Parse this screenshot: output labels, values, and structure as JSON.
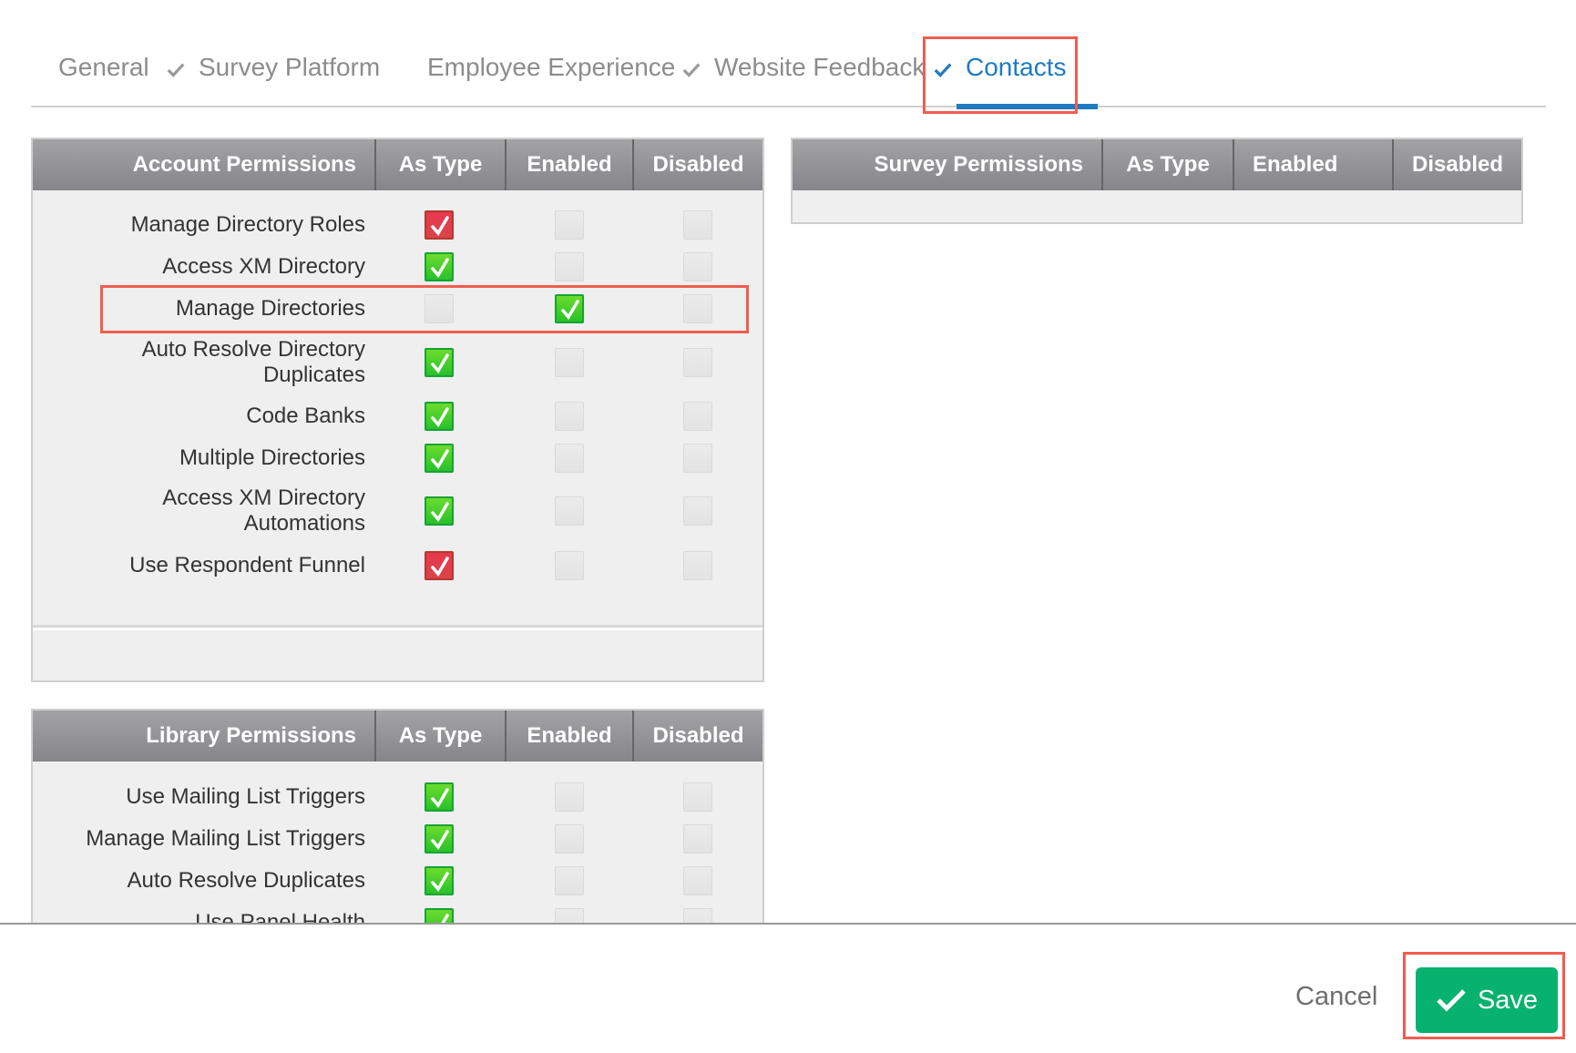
{
  "tabs": [
    {
      "label": "General",
      "checked": false,
      "active": false
    },
    {
      "label": "Survey Platform",
      "checked": true,
      "active": false
    },
    {
      "label": "Employee Experience",
      "checked": false,
      "active": false
    },
    {
      "label": "Website Feedback",
      "checked": true,
      "active": false
    },
    {
      "label": "Contacts",
      "checked": true,
      "active": true
    }
  ],
  "account_permissions": {
    "header": "Account Permissions",
    "columns": [
      "As Type",
      "Enabled",
      "Disabled"
    ],
    "rows": [
      {
        "label": "Manage Directory Roles",
        "as_type": "red",
        "enabled": "empty",
        "disabled": "empty"
      },
      {
        "label": "Access XM Directory",
        "as_type": "green",
        "enabled": "empty",
        "disabled": "empty"
      },
      {
        "label": "Manage Directories",
        "as_type": "empty",
        "enabled": "green",
        "disabled": "empty"
      },
      {
        "label": "Auto Resolve Directory Duplicates",
        "line1": "Auto Resolve Directory",
        "line2": "Duplicates",
        "as_type": "green",
        "enabled": "empty",
        "disabled": "empty"
      },
      {
        "label": "Code Banks",
        "as_type": "green",
        "enabled": "empty",
        "disabled": "empty"
      },
      {
        "label": "Multiple Directories",
        "as_type": "green",
        "enabled": "empty",
        "disabled": "empty"
      },
      {
        "label": "Access XM Directory Automations",
        "line1": "Access XM Directory",
        "line2": "Automations",
        "as_type": "green",
        "enabled": "empty",
        "disabled": "empty"
      },
      {
        "label": "Use Respondent Funnel",
        "as_type": "red",
        "enabled": "empty",
        "disabled": "empty"
      }
    ]
  },
  "survey_permissions": {
    "header": "Survey Permissions",
    "columns": [
      "As Type",
      "Enabled",
      "Disabled"
    ],
    "rows": []
  },
  "library_permissions": {
    "header": "Library Permissions",
    "columns": [
      "As Type",
      "Enabled",
      "Disabled"
    ],
    "rows": [
      {
        "label": "Use Mailing List Triggers",
        "as_type": "green",
        "enabled": "empty",
        "disabled": "empty"
      },
      {
        "label": "Manage Mailing List Triggers",
        "as_type": "green",
        "enabled": "empty",
        "disabled": "empty"
      },
      {
        "label": "Auto Resolve Duplicates",
        "as_type": "green",
        "enabled": "empty",
        "disabled": "empty"
      },
      {
        "label": "Use Panel Health",
        "as_type": "green",
        "enabled": "empty",
        "disabled": "empty"
      }
    ]
  },
  "footer": {
    "cancel_label": "Cancel",
    "save_label": "Save"
  },
  "colors": {
    "accent": "#1f7bc1",
    "save": "#07b26e",
    "highlight": "#f25c4f",
    "check_green": "#27c22a",
    "check_red": "#d94447"
  }
}
